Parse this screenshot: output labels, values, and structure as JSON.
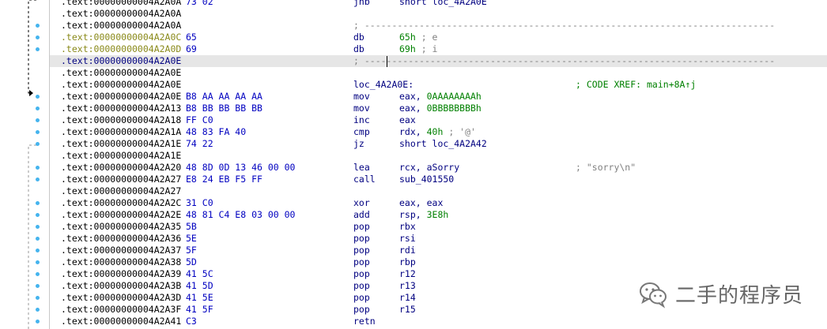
{
  "lines": [
    {
      "addr": ".text:00000000004A2A0A",
      "bytes": "73 02",
      "mn": "jnb",
      "op": "short loc_4A2A0E"
    },
    {
      "addr": ".text:00000000004A2A0A"
    },
    {
      "addr": ".text:00000000004A2A0A",
      "cm": "; ---------------------------------------------------------------------------"
    },
    {
      "addr": ".text:00000000004A2A0C",
      "bytes": "65",
      "mn": "db",
      "opn": "65h",
      "opc": " ; e",
      "dat": true
    },
    {
      "addr": ".text:00000000004A2A0D",
      "bytes": "69",
      "mn": "db",
      "opn": "69h",
      "opc": " ; i",
      "dat": true
    },
    {
      "addr": ".text:00000000004A2A0E",
      "cm": "; ---------------------------------------------------------------------------",
      "hl": true
    },
    {
      "addr": ".text:00000000004A2A0E"
    },
    {
      "addr": ".text:00000000004A2A0E",
      "label": "loc_4A2A0E:",
      "xref": "; CODE XREF: main+8A↑j"
    },
    {
      "addr": ".text:00000000004A2A0E",
      "bytes": "B8 AA AA AA AA",
      "mn": "mov",
      "op": "eax, ",
      "opn": "0AAAAAAAAh"
    },
    {
      "addr": ".text:00000000004A2A13",
      "bytes": "B8 BB BB BB BB",
      "mn": "mov",
      "op": "eax, ",
      "opn": "0BBBBBBBBh"
    },
    {
      "addr": ".text:00000000004A2A18",
      "bytes": "FF C0",
      "mn": "inc",
      "op": "eax"
    },
    {
      "addr": ".text:00000000004A2A1A",
      "bytes": "48 83 FA 40",
      "mn": "cmp",
      "op": "rdx, ",
      "opn": "40h",
      "opc": " ; '@'"
    },
    {
      "addr": ".text:00000000004A2A1E",
      "bytes": "74 22",
      "mn": "jz",
      "op": "short loc_4A2A42"
    },
    {
      "addr": ".text:00000000004A2A1E"
    },
    {
      "addr": ".text:00000000004A2A20",
      "bytes": "48 8D 0D 13 46 00 00",
      "mn": "lea",
      "op": "rcx, aSorry",
      "rc": "; \"sorry\\n\""
    },
    {
      "addr": ".text:00000000004A2A27",
      "bytes": "E8 24 EB F5 FF",
      "mn": "call",
      "op": "sub_401550"
    },
    {
      "addr": ".text:00000000004A2A27"
    },
    {
      "addr": ".text:00000000004A2A2C",
      "bytes": "31 C0",
      "mn": "xor",
      "op": "eax, eax"
    },
    {
      "addr": ".text:00000000004A2A2E",
      "bytes": "48 81 C4 E8 03 00 00",
      "mn": "add",
      "op": "rsp, ",
      "opn": "3E8h"
    },
    {
      "addr": ".text:00000000004A2A35",
      "bytes": "5B",
      "mn": "pop",
      "op": "rbx"
    },
    {
      "addr": ".text:00000000004A2A36",
      "bytes": "5E",
      "mn": "pop",
      "op": "rsi"
    },
    {
      "addr": ".text:00000000004A2A37",
      "bytes": "5F",
      "mn": "pop",
      "op": "rdi"
    },
    {
      "addr": ".text:00000000004A2A38",
      "bytes": "5D",
      "mn": "pop",
      "op": "rbp"
    },
    {
      "addr": ".text:00000000004A2A39",
      "bytes": "41 5C",
      "mn": "pop",
      "op": "r12"
    },
    {
      "addr": ".text:00000000004A2A3B",
      "bytes": "41 5D",
      "mn": "pop",
      "op": "r13"
    },
    {
      "addr": ".text:00000000004A2A3D",
      "bytes": "41 5E",
      "mn": "pop",
      "op": "r14"
    },
    {
      "addr": ".text:00000000004A2A3F",
      "bytes": "41 5F",
      "mn": "pop",
      "op": "r15"
    },
    {
      "addr": ".text:00000000004A2A41",
      "bytes": "C3",
      "mn": "retn"
    }
  ],
  "watermark": {
    "text": "二手的程序员",
    "icon": "wechat-icon"
  },
  "colors": {
    "address": "#000000",
    "data_address": "#8a8a1a",
    "bytes": "#0000c0",
    "instruction": "#000080",
    "number": "#008000",
    "comment": "#808080",
    "xref": "#008000",
    "highlight": "#e6e6e6",
    "gutter_dot": "#45b4ee"
  }
}
